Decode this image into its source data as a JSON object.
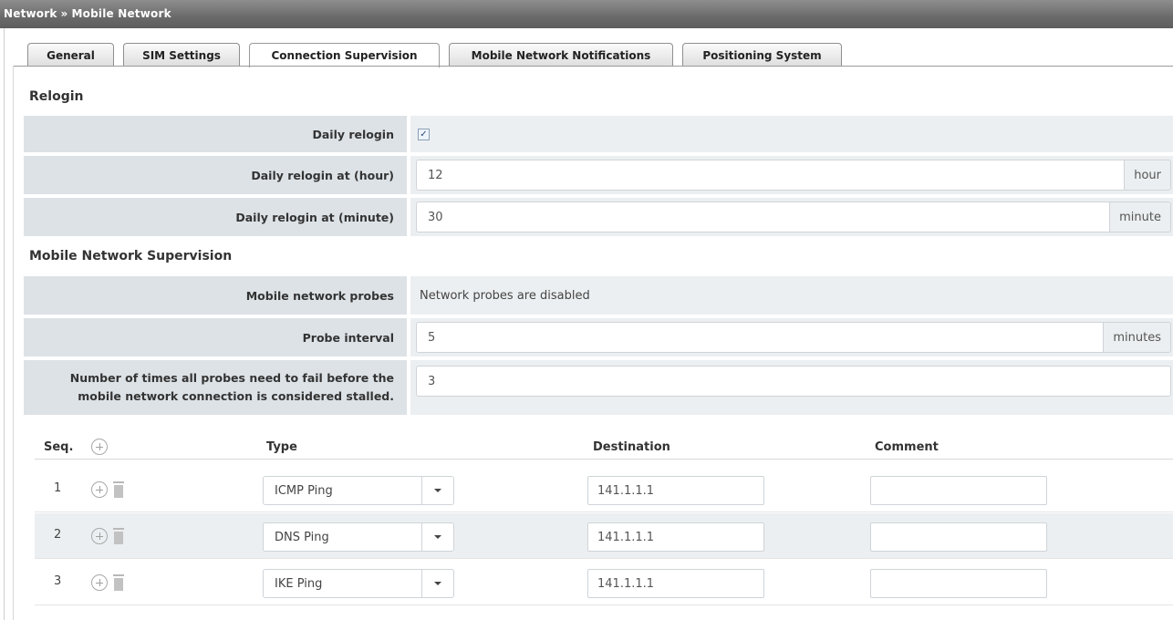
{
  "breadcrumb": {
    "root": "Network",
    "separator": "»",
    "current": "Mobile Network"
  },
  "tabs": [
    {
      "label": "General",
      "active": false
    },
    {
      "label": "SIM Settings",
      "active": false
    },
    {
      "label": "Connection Supervision",
      "active": true
    },
    {
      "label": "Mobile Network Notifications",
      "active": false
    },
    {
      "label": "Positioning System",
      "active": false
    }
  ],
  "relogin": {
    "title": "Relogin",
    "daily_relogin": {
      "label": "Daily relogin",
      "checked": true,
      "check_glyph": "✓"
    },
    "hour": {
      "label": "Daily relogin at (hour)",
      "value": "12",
      "unit": "hour"
    },
    "minute": {
      "label": "Daily relogin at (minute)",
      "value": "30",
      "unit": "minute"
    }
  },
  "supervision": {
    "title": "Mobile Network Supervision",
    "probes": {
      "label": "Mobile network probes",
      "value": "Network probes are disabled"
    },
    "interval": {
      "label": "Probe interval",
      "value": "5",
      "unit": "minutes"
    },
    "fail_count": {
      "label_line1": "Number of times all probes need to fail before the",
      "label_line2": "mobile network connection is considered stalled.",
      "value": "3"
    }
  },
  "probe_table": {
    "columns": {
      "seq": "Seq.",
      "type": "Type",
      "destination": "Destination",
      "comment": "Comment"
    },
    "rows": [
      {
        "seq": "1",
        "type": "ICMP Ping",
        "destination": "141.1.1.1",
        "comment": ""
      },
      {
        "seq": "2",
        "type": "DNS Ping",
        "destination": "141.1.1.1",
        "comment": ""
      },
      {
        "seq": "3",
        "type": "IKE Ping",
        "destination": "141.1.1.1",
        "comment": ""
      }
    ]
  },
  "colors": {
    "label_bg": "#dde2e6",
    "value_bg": "#eceff1",
    "topbar": "#6a6a6a"
  },
  "icons": {
    "add": "plus-circle-icon",
    "delete": "trash-icon",
    "dropdown": "caret-down-icon"
  }
}
